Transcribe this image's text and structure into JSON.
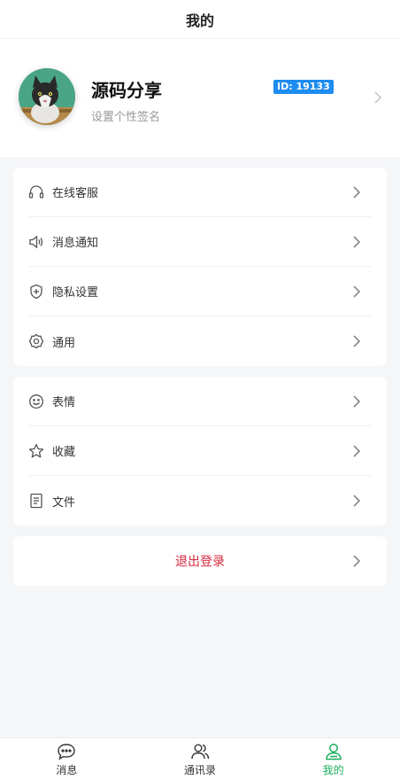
{
  "header": {
    "title": "我的"
  },
  "profile": {
    "nickname": "源码分享",
    "signature": "设置个性签名",
    "id_label": "ID: 19133"
  },
  "menu_group_1": [
    {
      "label": "在线客服",
      "icon": "headset-icon"
    },
    {
      "label": "消息通知",
      "icon": "speaker-icon"
    },
    {
      "label": "隐私设置",
      "icon": "shield-plus-icon"
    },
    {
      "label": "通用",
      "icon": "gear-icon"
    }
  ],
  "menu_group_2": [
    {
      "label": "表情",
      "icon": "smiley-icon"
    },
    {
      "label": "收藏",
      "icon": "star-icon"
    },
    {
      "label": "文件",
      "icon": "document-icon"
    }
  ],
  "logout": {
    "label": "退出登录"
  },
  "tabbar": [
    {
      "label": "消息",
      "icon": "chat-bubble-icon",
      "active": false
    },
    {
      "label": "通讯录",
      "icon": "contacts-icon",
      "active": false
    },
    {
      "label": "我的",
      "icon": "user-icon",
      "active": true
    }
  ],
  "colors": {
    "accent": "#1aad5c",
    "badge": "#1e8cf0",
    "danger": "#d6263b",
    "background": "#f5f6f8"
  }
}
